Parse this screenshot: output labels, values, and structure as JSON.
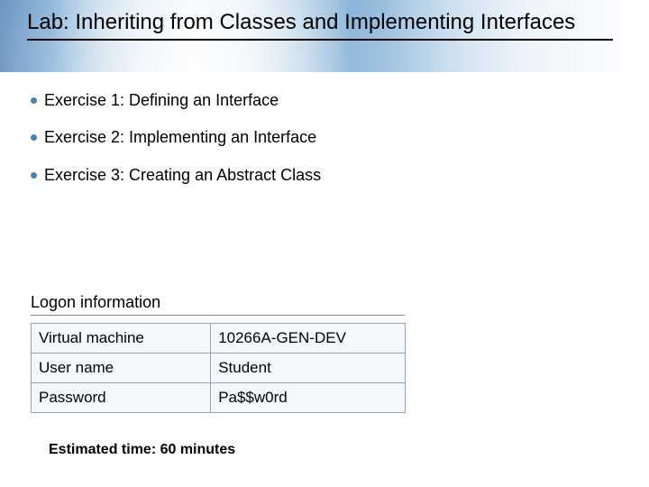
{
  "title": "Lab: Inheriting from Classes and Implementing Interfaces",
  "bullets": [
    "Exercise 1: Defining an Interface",
    "Exercise 2: Implementing an Interface",
    "Exercise 3: Creating an Abstract Class"
  ],
  "logon": {
    "heading": "Logon information",
    "rows": [
      {
        "label": "Virtual machine",
        "value": "10266A-GEN-DEV"
      },
      {
        "label": "User name",
        "value": "Student"
      },
      {
        "label": "Password",
        "value": "Pa$$w0rd"
      }
    ]
  },
  "estimated": "Estimated time: 60 minutes"
}
